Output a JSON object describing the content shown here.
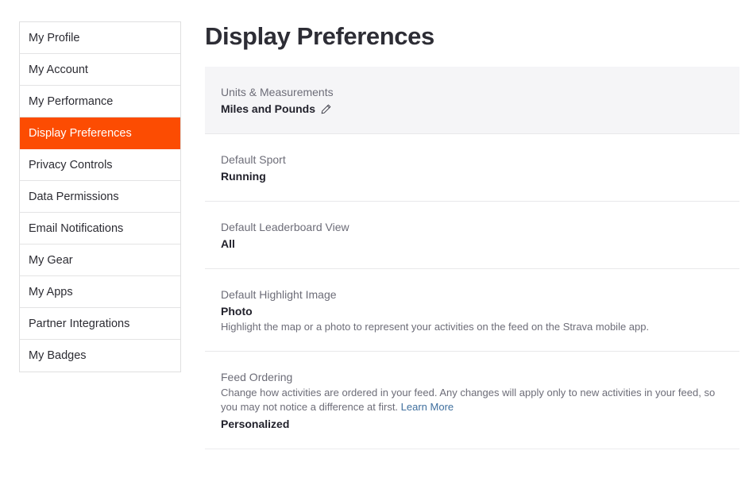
{
  "sidebar": {
    "items": [
      {
        "label": "My Profile",
        "active": false
      },
      {
        "label": "My Account",
        "active": false
      },
      {
        "label": "My Performance",
        "active": false
      },
      {
        "label": "Display Preferences",
        "active": true
      },
      {
        "label": "Privacy Controls",
        "active": false
      },
      {
        "label": "Data Permissions",
        "active": false
      },
      {
        "label": "Email Notifications",
        "active": false
      },
      {
        "label": "My Gear",
        "active": false
      },
      {
        "label": "My Apps",
        "active": false
      },
      {
        "label": "Partner Integrations",
        "active": false
      },
      {
        "label": "My Badges",
        "active": false
      }
    ]
  },
  "main": {
    "title": "Display Preferences",
    "preferences": [
      {
        "label": "Units & Measurements",
        "value": "Miles and Pounds",
        "edit_icon": "pencil-edit-icon",
        "description": "",
        "description_position": "none",
        "highlighted": true
      },
      {
        "label": "Default Sport",
        "value": "Running",
        "edit_icon": "",
        "description": "",
        "description_position": "none",
        "highlighted": false
      },
      {
        "label": "Default Leaderboard View",
        "value": "All",
        "edit_icon": "",
        "description": "",
        "description_position": "none",
        "highlighted": false
      },
      {
        "label": "Default Highlight Image",
        "value": "Photo",
        "edit_icon": "",
        "description": "Highlight the map or a photo to represent your activities on the feed on the Strava mobile app.",
        "description_position": "below",
        "highlighted": false
      },
      {
        "label": "Feed Ordering",
        "value": "Personalized",
        "edit_icon": "",
        "description": "Change how activities are ordered in your feed. Any changes will apply only to new activities in your feed, so you may not notice a difference at first. ",
        "description_link": "Learn More",
        "description_position": "above",
        "highlighted": false
      }
    ]
  },
  "colors": {
    "brand_orange": "#fc4c02",
    "link_blue": "#3f6f9e",
    "label_gray": "#6d6d78",
    "value_dark": "#22222c",
    "highlight_bg": "#f5f5f7"
  }
}
